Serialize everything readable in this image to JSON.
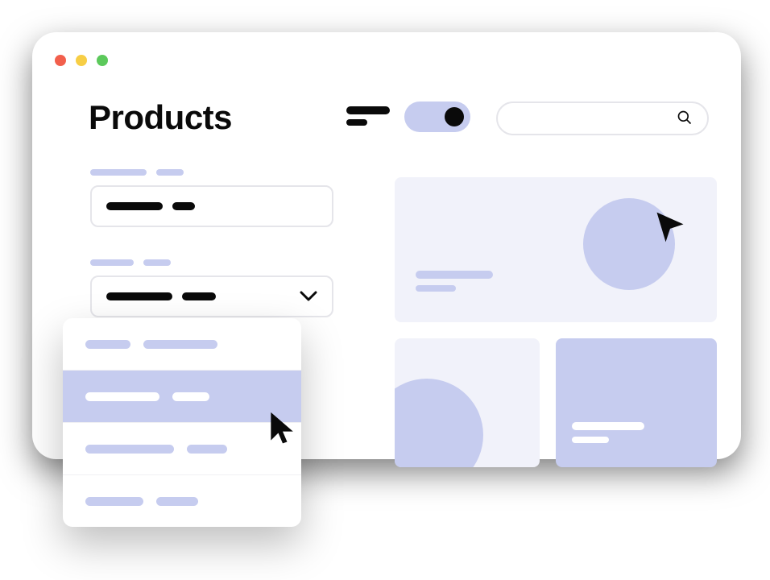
{
  "colors": {
    "lavender": "#c6ccef",
    "card_bg": "#f1f2fa",
    "red": "#f25f4c",
    "yellow": "#f7ce45",
    "green": "#5cc95b"
  },
  "window": {
    "traffic": [
      "close",
      "minimize",
      "maximize"
    ]
  },
  "header": {
    "title": "Products",
    "toggle_state": "on",
    "search_placeholder": ""
  },
  "filters": [
    {
      "type": "text",
      "label_placeholder": "",
      "value_placeholder": ""
    },
    {
      "type": "select",
      "label_placeholder": "",
      "value_placeholder": "",
      "expanded": true
    }
  ],
  "dropdown": {
    "items": [
      {
        "hover": false
      },
      {
        "hover": true
      },
      {
        "hover": false
      },
      {
        "hover": false
      }
    ]
  },
  "cards": [
    {
      "kind": "hero",
      "shape": "circle",
      "cursor": true
    },
    {
      "kind": "small",
      "shape": "quarter"
    },
    {
      "kind": "small",
      "shape": "solid",
      "text": true
    }
  ]
}
